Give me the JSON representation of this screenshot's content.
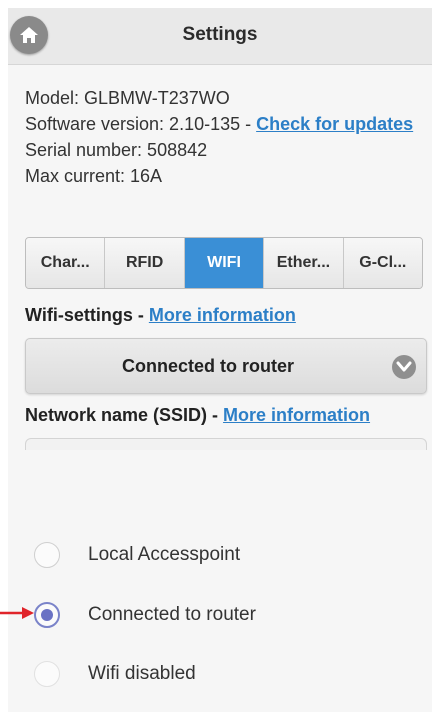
{
  "header": {
    "title": "Settings",
    "home_icon": "home-icon"
  },
  "info": {
    "model": "Model: GLBMW-T237WO",
    "software_prefix": "Software version: 2.10-135 - ",
    "check_updates_label": "Check for updates",
    "serial": "Serial number: 508842",
    "max_current": "Max current: 16A"
  },
  "tabs": [
    {
      "label": "Char...",
      "active": false
    },
    {
      "label": "RFID",
      "active": false
    },
    {
      "label": "WIFI",
      "active": true
    },
    {
      "label": "Ether...",
      "active": false
    },
    {
      "label": "G-Cl...",
      "active": false
    }
  ],
  "wifi": {
    "label": "Wifi-settings - ",
    "more_info": "More information",
    "dropdown_value": "Connected to router",
    "dropdown_icon": "chevron-down-icon"
  },
  "ssid": {
    "label": "Network name (SSID) - ",
    "more_info": "More information"
  },
  "options": [
    {
      "label": "Local Accesspoint",
      "checked": false
    },
    {
      "label": "Connected to router",
      "checked": true
    },
    {
      "label": "Wifi disabled",
      "checked": false
    }
  ],
  "colors": {
    "accent": "#3a8fd6",
    "link": "#2c7fc7",
    "radio_selected": "#6a72c4",
    "arrow": "#e0242a"
  }
}
